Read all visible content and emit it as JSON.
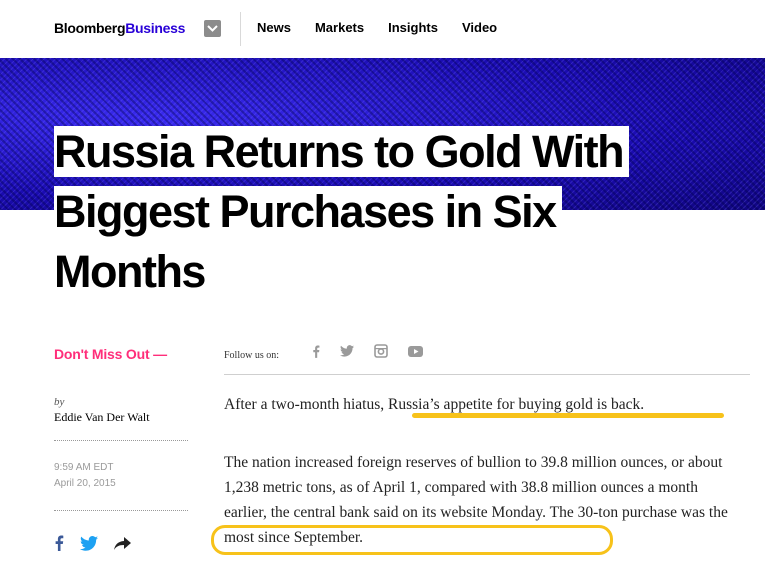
{
  "header": {
    "logo_brand": "Bloomberg",
    "logo_section": "Business",
    "nav": [
      "News",
      "Markets",
      "Insights",
      "Video"
    ]
  },
  "article": {
    "headline_lines": [
      "Russia Returns to Gold With",
      "Biggest Purchases in Six",
      "Months"
    ],
    "dont_miss": "Don't Miss Out —",
    "by": "by",
    "author": "Eddie Van Der Walt",
    "time": "9:59 AM EDT",
    "date": "April 20, 2015",
    "follow_label": "Follow us on:",
    "paragraph1": "After a two-month hiatus, Russia’s appetite for buying gold is back.",
    "paragraph2": "The nation increased foreign reserves of bullion to 39.8 million ounces, or about 1,238 metric tons, as of April 1, compared with 38.8 million ounces a month earlier, the central bank said on its website Monday. The 30-ton purchase was the most since September."
  },
  "colors": {
    "accent_pink": "#ff2e7a",
    "brand_blue": "#2800d7",
    "hero_blue": "#1f10c8",
    "annotation_yellow": "#f7c21a",
    "facebook": "#3b5998",
    "twitter": "#1da1f2"
  },
  "icons": {
    "menu": "chevron-down-icon",
    "follow": [
      "facebook-icon",
      "twitter-icon",
      "instagram-icon",
      "youtube-icon"
    ],
    "share": [
      "facebook-icon",
      "twitter-icon",
      "share-arrow-icon"
    ]
  }
}
